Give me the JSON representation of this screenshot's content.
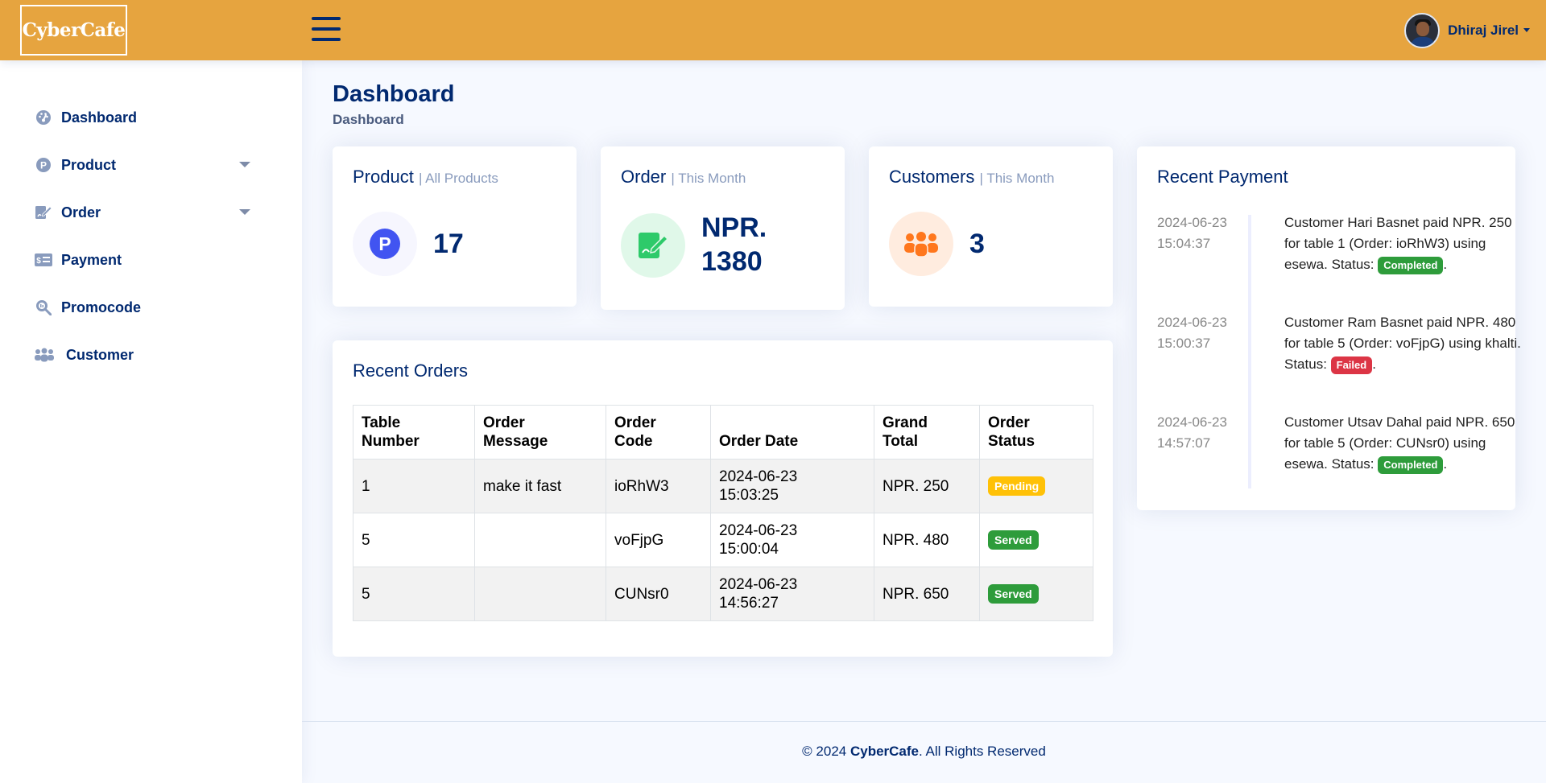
{
  "header": {
    "logo_text": "CyberCafe",
    "user_name": "Dhiraj Jirel"
  },
  "sidebar": {
    "items": [
      {
        "label": "Dashboard",
        "icon": "gauge-icon"
      },
      {
        "label": "Product",
        "icon": "p-circle-icon"
      },
      {
        "label": "Order",
        "icon": "order-edit-icon"
      },
      {
        "label": "Payment",
        "icon": "payment-card-icon"
      },
      {
        "label": "Promocode",
        "icon": "search-tag-icon"
      },
      {
        "label": "Customer",
        "icon": "people-icon"
      }
    ]
  },
  "page": {
    "title": "Dashboard",
    "breadcrumb": "Dashboard"
  },
  "cards": {
    "product": {
      "title": "Product",
      "sub": "| All Products",
      "value": "17"
    },
    "order": {
      "title": "Order",
      "sub": "| This Month",
      "value_line1": "NPR.",
      "value_line2": "1380"
    },
    "customers": {
      "title": "Customers",
      "sub": "| This Month",
      "value": "3"
    }
  },
  "recent_orders": {
    "title": "Recent Orders",
    "columns": [
      {
        "line1": "Table",
        "line2": "Number"
      },
      {
        "line1": "Order",
        "line2": "Message"
      },
      {
        "line1": "Order",
        "line2": "Code"
      },
      {
        "line1": "",
        "line2": "Order Date"
      },
      {
        "line1": "Grand",
        "line2": "Total"
      },
      {
        "line1": "Order",
        "line2": "Status"
      }
    ],
    "rows": [
      {
        "table": "1",
        "message": "make it fast",
        "code": "ioRhW3",
        "date": "2024-06-23",
        "time": "15:03:25",
        "total": "NPR. 250",
        "status": "Pending"
      },
      {
        "table": "5",
        "message": "",
        "code": "voFjpG",
        "date": "2024-06-23",
        "time": "15:00:04",
        "total": "NPR. 480",
        "status": "Served"
      },
      {
        "table": "5",
        "message": "",
        "code": "CUNsr0",
        "date": "2024-06-23",
        "time": "14:56:27",
        "total": "NPR. 650",
        "status": "Served"
      }
    ]
  },
  "recent_payment": {
    "title": "Recent Payment",
    "items": [
      {
        "date": "2024-06-23",
        "time": "15:04:37",
        "text": "Customer Hari Basnet paid NPR. 250 for table 1 (Order: ioRhW3) using esewa. Status: ",
        "status": "Completed"
      },
      {
        "date": "2024-06-23",
        "time": "15:00:37",
        "text": "Customer Ram Basnet paid NPR. 480 for table 5 (Order: voFjpG) using khalti. Status: ",
        "status": "Failed"
      },
      {
        "date": "2024-06-23",
        "time": "14:57:07",
        "text": "Customer Utsav Dahal paid NPR. 650 for table 5 (Order: CUNsr0) using esewa. Status: ",
        "status": "Completed"
      }
    ]
  },
  "footer": {
    "prefix": "© 2024 ",
    "brand": "CyberCafe",
    "suffix": ". All Rights Reserved"
  },
  "colors": {
    "header": "#e6a43f",
    "navy": "#012970",
    "pending": "#ffc107",
    "served": "#2e9c3b",
    "failed": "#dc3545"
  }
}
